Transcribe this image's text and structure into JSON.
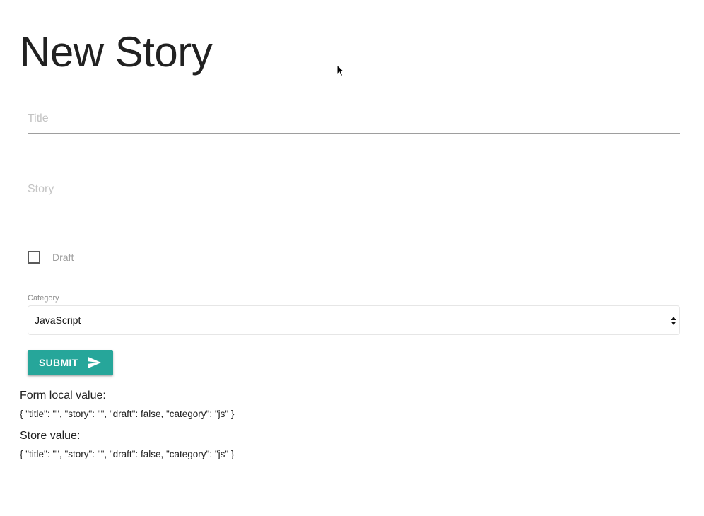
{
  "page": {
    "title": "New Story"
  },
  "form": {
    "title_field": {
      "placeholder": "Title",
      "value": ""
    },
    "story_field": {
      "placeholder": "Story",
      "value": ""
    },
    "draft_checkbox": {
      "label": "Draft",
      "checked": false
    },
    "category": {
      "label": "Category",
      "selected": "JavaScript"
    },
    "submit": {
      "label": "SUBMIT",
      "icon": "send-icon"
    }
  },
  "debug": {
    "local_heading": "Form local value:",
    "local_value": "{ \"title\": \"\", \"story\": \"\", \"draft\": false, \"category\": \"js\" }",
    "store_heading": "Store value:",
    "store_value": "{ \"title\": \"\", \"story\": \"\", \"draft\": false, \"category\": \"js\" }"
  },
  "colors": {
    "accent": "#26a69a",
    "text": "#212121",
    "placeholder": "#c4c4c4",
    "underline": "#9e9e9e"
  }
}
